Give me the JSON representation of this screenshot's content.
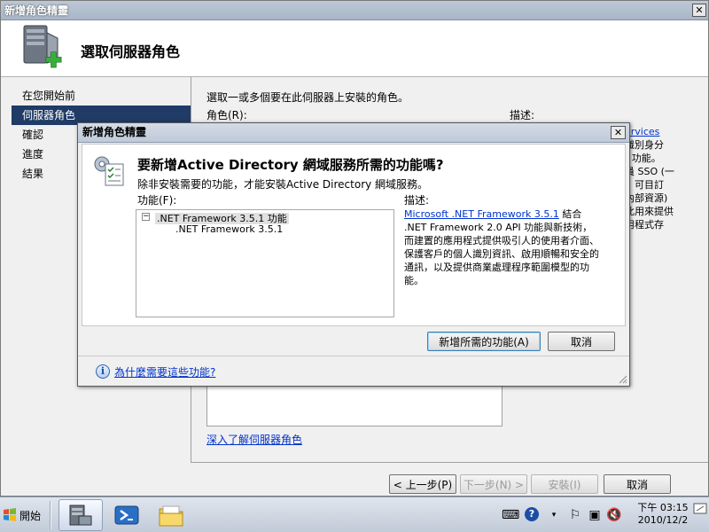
{
  "wizard": {
    "title": "新增角色精靈",
    "header_title": "選取伺服器角色",
    "nav": [
      "在您開始前",
      "伺服器角色",
      "確認",
      "進度",
      "結果"
    ],
    "content_prompt": "選取一或多個要在此伺服器上安裝的角色。",
    "roles_label": "角色(R):",
    "desc_label": "描述:",
    "desc_fragments": [
      "ervices",
      "識別身分",
      ") 功能。",
      "員 SSO (一",
      "，可目訂",
      "內部資源)",
      "此用來提供",
      "用程式存"
    ],
    "learn_more": "深入了解伺服器角色",
    "buttons": {
      "prev": "< 上一步(P)",
      "next": "下一步(N) >",
      "install": "安裝(I)",
      "cancel": "取消"
    }
  },
  "dialog": {
    "title": "新增角色精靈",
    "question": "要新增Active Directory 網域服務所需的功能嗎?",
    "subtitle": "除非安裝需要的功能，才能安裝Active Directory 網域服務。",
    "features_label": "功能(F):",
    "tree": {
      "parent": ".NET Framework 3.5.1 功能",
      "child": ".NET Framework 3.5.1",
      "expander": "−"
    },
    "desc_label": "描述:",
    "desc_link": "Microsoft .NET Framework 3.5.1",
    "desc_text": " 結合 .NET Framework 2.0 API 功能與新技術，而建置的應用程式提供吸引人的使用者介面、保護客戶的個人識別資訊、啟用順暢和安全的通訊，以及提供商業處理程序範圍模型的功能。",
    "add_button": "新增所需的功能(A)",
    "cancel_button": "取消",
    "help_link": "為什麼需要這些功能?"
  },
  "taskbar": {
    "start_label": "開始",
    "clock_time": "下午 03:15",
    "clock_date": "2010/12/2"
  }
}
